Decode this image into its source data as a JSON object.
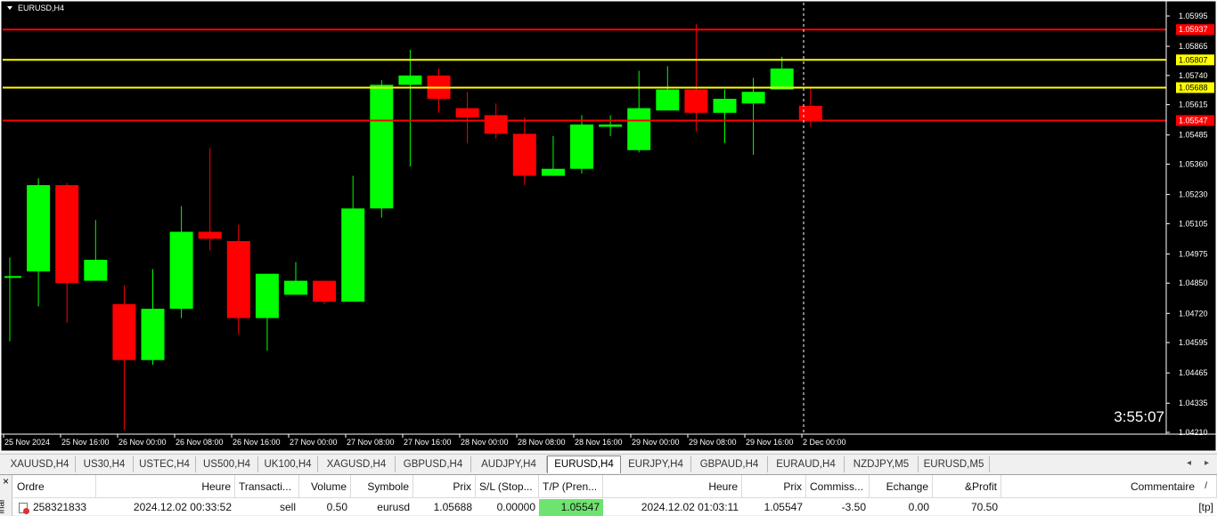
{
  "chart": {
    "symbol_label": "EURUSD,H4",
    "timer": "3:55:07",
    "price_min": 1.0421,
    "price_max": 1.06029,
    "price_ticks": [
      "1.05995",
      "1.05865",
      "1.05740",
      "1.05615",
      "1.05485",
      "1.05360",
      "1.05230",
      "1.05105",
      "1.04975",
      "1.04850",
      "1.04720",
      "1.04595",
      "1.04465",
      "1.04335",
      "1.04210"
    ],
    "time_ticks": [
      "25 Nov 2024",
      "25 Nov 16:00",
      "26 Nov 00:00",
      "26 Nov 08:00",
      "26 Nov 16:00",
      "27 Nov 00:00",
      "27 Nov 08:00",
      "27 Nov 16:00",
      "28 Nov 00:00",
      "28 Nov 08:00",
      "28 Nov 16:00",
      "29 Nov 00:00",
      "29 Nov 08:00",
      "29 Nov 16:00",
      "2 Dec 00:00"
    ],
    "hlines": [
      {
        "price": 1.05937,
        "label": "1.05937",
        "color": "#ff0000"
      },
      {
        "price": 1.05807,
        "label": "1.05807",
        "color": "#ffff00"
      },
      {
        "price": 1.05688,
        "label": "1.05688",
        "color": "#ffff00"
      },
      {
        "price": 1.05547,
        "label": "1.05547",
        "color": "#ff0000"
      }
    ],
    "colors": {
      "bull": "#00ff00",
      "bear": "#ff0000",
      "background": "#000000",
      "frame": "#ffffff"
    }
  },
  "chart_data": {
    "type": "candlestick",
    "series": [
      {
        "o": 1.0488,
        "h": 1.0496,
        "l": 1.046,
        "c": 1.0488
      },
      {
        "o": 1.049,
        "h": 1.053,
        "l": 1.0475,
        "c": 1.0527
      },
      {
        "o": 1.0527,
        "h": 1.0528,
        "l": 1.0468,
        "c": 1.0485
      },
      {
        "o": 1.0486,
        "h": 1.0512,
        "l": 1.0486,
        "c": 1.0495
      },
      {
        "o": 1.0476,
        "h": 1.0484,
        "l": 1.0422,
        "c": 1.0452
      },
      {
        "o": 1.0452,
        "h": 1.0491,
        "l": 1.045,
        "c": 1.0474
      },
      {
        "o": 1.0474,
        "h": 1.0518,
        "l": 1.047,
        "c": 1.0507
      },
      {
        "o": 1.0507,
        "h": 1.0543,
        "l": 1.0499,
        "c": 1.0504
      },
      {
        "o": 1.0503,
        "h": 1.051,
        "l": 1.0463,
        "c": 1.047
      },
      {
        "o": 1.047,
        "h": 1.0489,
        "l": 1.0456,
        "c": 1.0489
      },
      {
        "o": 1.048,
        "h": 1.0494,
        "l": 1.048,
        "c": 1.0486
      },
      {
        "o": 1.0486,
        "h": 1.0486,
        "l": 1.0476,
        "c": 1.0477
      },
      {
        "o": 1.0477,
        "h": 1.0531,
        "l": 1.0477,
        "c": 1.0517
      },
      {
        "o": 1.0517,
        "h": 1.0572,
        "l": 1.0513,
        "c": 1.057
      },
      {
        "o": 1.057,
        "h": 1.0585,
        "l": 1.0535,
        "c": 1.0574
      },
      {
        "o": 1.0574,
        "h": 1.0577,
        "l": 1.0558,
        "c": 1.0564
      },
      {
        "o": 1.056,
        "h": 1.0567,
        "l": 1.0545,
        "c": 1.0556
      },
      {
        "o": 1.0557,
        "h": 1.0562,
        "l": 1.0547,
        "c": 1.0549
      },
      {
        "o": 1.0549,
        "h": 1.0556,
        "l": 1.0527,
        "c": 1.0531
      },
      {
        "o": 1.0531,
        "h": 1.0548,
        "l": 1.0531,
        "c": 1.0534
      },
      {
        "o": 1.0534,
        "h": 1.0557,
        "l": 1.0532,
        "c": 1.0553
      },
      {
        "o": 1.0552,
        "h": 1.0557,
        "l": 1.0548,
        "c": 1.0553
      },
      {
        "o": 1.0542,
        "h": 1.0576,
        "l": 1.0541,
        "c": 1.056
      },
      {
        "o": 1.0559,
        "h": 1.0578,
        "l": 1.0559,
        "c": 1.0568
      },
      {
        "o": 1.0568,
        "h": 1.0596,
        "l": 1.055,
        "c": 1.0558
      },
      {
        "o": 1.0558,
        "h": 1.0568,
        "l": 1.0545,
        "c": 1.0564
      },
      {
        "o": 1.0562,
        "h": 1.0573,
        "l": 1.054,
        "c": 1.0567
      },
      {
        "o": 1.0568,
        "h": 1.0582,
        "l": 1.0568,
        "c": 1.0577
      },
      {
        "o": 1.0561,
        "h": 1.0569,
        "l": 1.0552,
        "c": 1.0555
      }
    ]
  },
  "tabs": {
    "items": [
      "XAUUSD,H4",
      "US30,H4",
      "USTEC,H4",
      "US500,H4",
      "UK100,H4",
      "XAGUSD,H4",
      "GBPUSD,H4",
      "AUDJPY,H4",
      "EURUSD,H4",
      "EURJPY,H4",
      "GBPAUD,H4",
      "EURAUD,H4",
      "NZDJPY,M5",
      "EURUSD,M5"
    ],
    "active_index": 8,
    "arrow_left": "◂",
    "arrow_right": "▸"
  },
  "terminal": {
    "side_close": "×",
    "side_label": "inal",
    "headers": [
      "Ordre",
      "Heure",
      "Transacti...",
      "Volume",
      "Symbole",
      "Prix",
      "S/L (Stop...",
      "T/P (Pren...",
      "Heure",
      "Prix",
      "Commiss...",
      "Echange",
      "&Profit",
      "Commentaire"
    ],
    "header_sort_mark": "/",
    "row": [
      "258321833",
      "2024.12.02 00:33:52",
      "sell",
      "0.50",
      "eurusd",
      "1.05688",
      "0.00000",
      "1.05547",
      "2024.12.02 01:03:11",
      "1.05547",
      "-3.50",
      "0.00",
      "70.50",
      "[tp]"
    ],
    "tp_highlight": "#6fe36f",
    "order_icon_color": "#e03030"
  }
}
